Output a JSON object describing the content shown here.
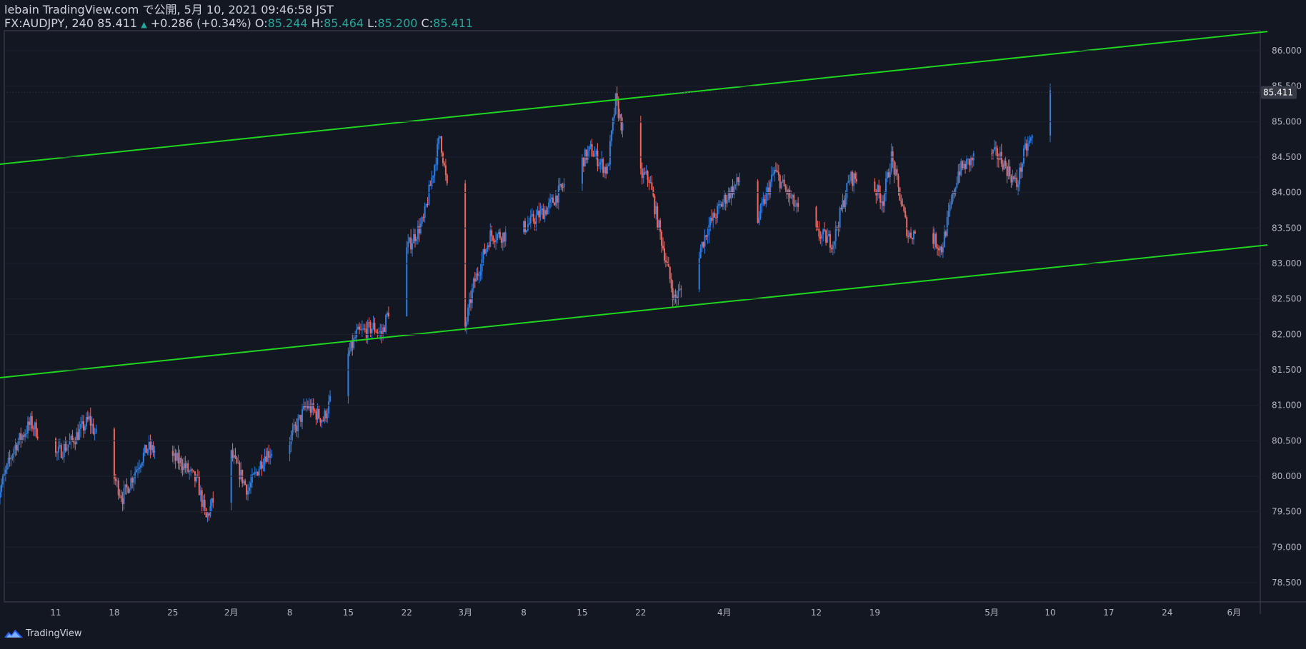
{
  "header": {
    "publish_line": "lebain TradingView.com で公開, 5月 10, 2021 09:46:58 JST",
    "symbol": "FX:AUDJPY, 240",
    "last": "85.411",
    "change": "+0.286 (+0.34%)",
    "o_label": "O:",
    "o_value": "85.244",
    "h_label": "H:",
    "h_value": "85.464",
    "l_label": "L:",
    "l_value": "85.200",
    "c_label": "C:",
    "c_value": "85.411"
  },
  "footer": {
    "brand": "TradingView"
  },
  "colors": {
    "background": "#131722",
    "up": "#2f7ee0",
    "down": "#f0675f",
    "channel": "#1fd61f",
    "axis_text": "#b2b5be",
    "last_price_badge": "#363a45"
  },
  "chart_data": {
    "type": "candlestick",
    "title": "",
    "ylim": [
      78.1,
      86.3
    ],
    "y_ticks": [
      "78.500",
      "79.000",
      "79.500",
      "80.000",
      "80.500",
      "81.000",
      "81.500",
      "82.000",
      "82.500",
      "83.000",
      "83.500",
      "84.000",
      "84.500",
      "85.000",
      "85.500",
      "86.000"
    ],
    "x_ticks": [
      {
        "label": "11",
        "date": "2021-01-11"
      },
      {
        "label": "18",
        "date": "2021-01-18"
      },
      {
        "label": "25",
        "date": "2021-01-25"
      },
      {
        "label": "2月",
        "date": "2021-02-01"
      },
      {
        "label": "8",
        "date": "2021-02-08"
      },
      {
        "label": "15",
        "date": "2021-02-15"
      },
      {
        "label": "22",
        "date": "2021-02-22"
      },
      {
        "label": "3月",
        "date": "2021-03-01"
      },
      {
        "label": "8",
        "date": "2021-03-08"
      },
      {
        "label": "15",
        "date": "2021-03-15"
      },
      {
        "label": "22",
        "date": "2021-03-22"
      },
      {
        "label": "4月",
        "date": "2021-04-01"
      },
      {
        "label": "12",
        "date": "2021-04-12"
      },
      {
        "label": "19",
        "date": "2021-04-19"
      },
      {
        "label": "5月",
        "date": "2021-05-03"
      },
      {
        "label": "10",
        "date": "2021-05-10"
      },
      {
        "label": "17",
        "date": "2021-05-17"
      },
      {
        "label": "24",
        "date": "2021-05-24"
      },
      {
        "label": "6月",
        "date": "2021-06-01"
      }
    ],
    "last_price": 85.411,
    "last_price_label": "85.411",
    "channel_lines": [
      {
        "name": "upper",
        "start": {
          "date": "2021-01-02",
          "price": 84.37
        },
        "end": {
          "date": "2021-06-05",
          "price": 86.27
        }
      },
      {
        "name": "lower",
        "start": {
          "date": "2021-01-02",
          "price": 81.36
        },
        "end": {
          "date": "2021-06-05",
          "price": 83.26
        }
      }
    ],
    "close_path": [
      [
        "2021-01-02",
        79.2
      ],
      [
        "2021-01-04",
        79.7
      ],
      [
        "2021-01-06",
        80.4
      ],
      [
        "2021-01-08",
        80.75
      ],
      [
        "2021-01-11",
        80.3
      ],
      [
        "2021-01-13",
        80.5
      ],
      [
        "2021-01-15",
        80.8
      ],
      [
        "2021-01-19",
        79.7
      ],
      [
        "2021-01-21",
        80.2
      ],
      [
        "2021-01-22",
        80.4
      ],
      [
        "2021-01-26",
        80.2
      ],
      [
        "2021-01-28",
        79.9
      ],
      [
        "2021-01-29",
        79.4
      ],
      [
        "2021-02-01",
        80.3
      ],
      [
        "2021-02-03",
        79.8
      ],
      [
        "2021-02-05",
        80.3
      ],
      [
        "2021-02-08",
        80.5
      ],
      [
        "2021-02-10",
        81.0
      ],
      [
        "2021-02-12",
        80.8
      ],
      [
        "2021-02-16",
        82.0
      ],
      [
        "2021-02-18",
        82.1
      ],
      [
        "2021-02-19",
        82.0
      ],
      [
        "2021-02-22",
        83.2
      ],
      [
        "2021-02-24",
        83.6
      ],
      [
        "2021-02-26",
        84.8
      ],
      [
        "2021-03-01",
        82.1
      ],
      [
        "2021-03-02",
        82.7
      ],
      [
        "2021-03-04",
        83.4
      ],
      [
        "2021-03-07",
        83.4
      ],
      [
        "2021-03-09",
        83.6
      ],
      [
        "2021-03-11",
        83.8
      ],
      [
        "2021-03-14",
        84.3
      ],
      [
        "2021-03-16",
        84.6
      ],
      [
        "2021-03-18",
        84.3
      ],
      [
        "2021-03-19",
        85.3
      ],
      [
        "2021-03-21",
        84.3
      ],
      [
        "2021-03-23",
        84.2
      ],
      [
        "2021-03-24",
        83.6
      ],
      [
        "2021-03-26",
        82.5
      ],
      [
        "2021-03-28",
        82.8
      ],
      [
        "2021-03-30",
        83.5
      ],
      [
        "2021-04-01",
        83.9
      ],
      [
        "2021-04-03",
        84.2
      ],
      [
        "2021-04-05",
        83.6
      ],
      [
        "2021-04-07",
        84.3
      ],
      [
        "2021-04-09",
        83.9
      ],
      [
        "2021-04-11",
        83.5
      ],
      [
        "2021-04-14",
        83.3
      ],
      [
        "2021-04-16",
        84.2
      ],
      [
        "2021-04-18",
        84.2
      ],
      [
        "2021-04-20",
        83.9
      ],
      [
        "2021-04-21",
        84.5
      ],
      [
        "2021-04-23",
        83.4
      ],
      [
        "2021-04-25",
        83.5
      ],
      [
        "2021-04-27",
        83.2
      ],
      [
        "2021-04-29",
        84.3
      ],
      [
        "2021-05-02",
        84.6
      ],
      [
        "2021-05-04",
        84.5
      ],
      [
        "2021-05-06",
        84.1
      ],
      [
        "2021-05-07",
        84.6
      ],
      [
        "2021-05-09",
        85.0
      ],
      [
        "2021-05-10",
        85.41
      ]
    ]
  }
}
